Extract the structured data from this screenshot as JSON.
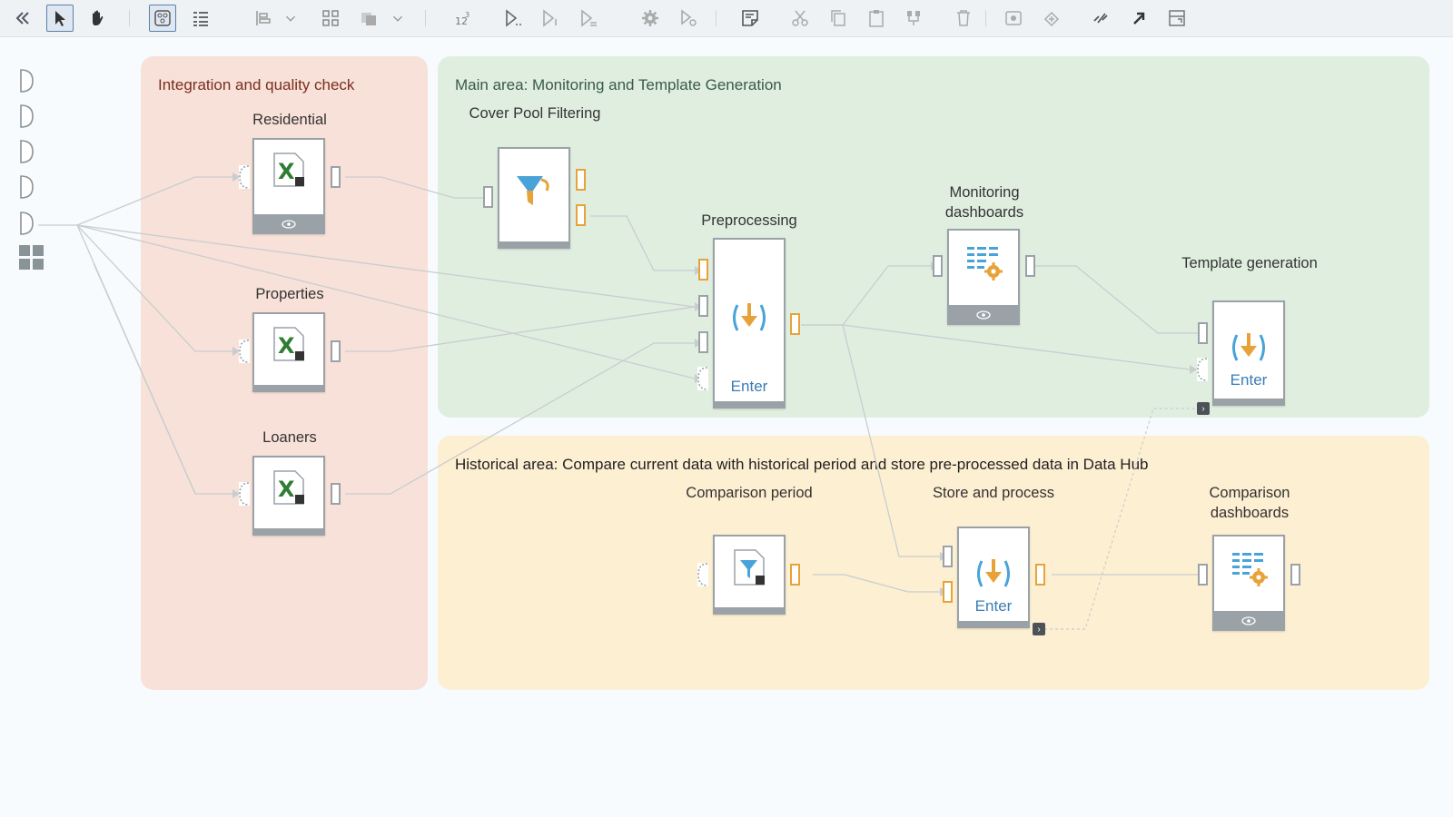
{
  "toolbar": {
    "tools": [
      {
        "name": "collapse-icon",
        "selected": false
      },
      {
        "name": "select-arrow-icon",
        "selected": true
      },
      {
        "name": "pan-hand-icon",
        "selected": false
      },
      {
        "name": "workflow-view-icon",
        "selected": true
      },
      {
        "name": "list-view-icon",
        "selected": false
      },
      {
        "name": "align-icon",
        "selected": false
      },
      {
        "name": "layout-icon",
        "selected": false
      },
      {
        "name": "arrange-icon",
        "selected": false
      },
      {
        "name": "numbering-icon",
        "selected": false
      },
      {
        "name": "run-all-icon",
        "selected": false
      },
      {
        "name": "run-step-icon",
        "selected": false
      },
      {
        "name": "run-selected-icon",
        "selected": false
      },
      {
        "name": "settings-gear-icon",
        "selected": false
      },
      {
        "name": "run-settings-icon",
        "selected": false
      },
      {
        "name": "note-icon",
        "selected": false
      },
      {
        "name": "cut-icon",
        "selected": false
      },
      {
        "name": "copy-icon",
        "selected": false
      },
      {
        "name": "paste-icon",
        "selected": false
      },
      {
        "name": "group-icon",
        "selected": false
      },
      {
        "name": "delete-icon",
        "selected": false
      },
      {
        "name": "preview-icon",
        "selected": false
      },
      {
        "name": "connect-icon",
        "selected": false
      },
      {
        "name": "link-icon",
        "selected": false
      },
      {
        "name": "export-icon",
        "selected": false
      },
      {
        "name": "fit-frame-icon",
        "selected": false
      }
    ]
  },
  "areas": {
    "integration": {
      "title": "Integration and quality check",
      "color": "#f8e1d8",
      "title_color": "#7a2e1f"
    },
    "main": {
      "title": "Main area: Monitoring and Template Generation",
      "color": "#e0eee0",
      "title_color": "#3a5a4a"
    },
    "historical": {
      "title": "Historical area: Compare current data with historical period and store pre-processed data in Data Hub",
      "color": "#fdefd1",
      "title_color": "#222"
    }
  },
  "nodes": {
    "residential": {
      "label": "Residential",
      "icon": "excel-icon"
    },
    "properties": {
      "label": "Properties",
      "icon": "excel-icon"
    },
    "loaners": {
      "label": "Loaners",
      "icon": "excel-icon"
    },
    "cover_pool": {
      "label": "Cover Pool Filtering",
      "icon": "funnel-filter-icon"
    },
    "preprocessing": {
      "label": "Preprocessing",
      "icon": "process-icon",
      "action": "Enter"
    },
    "monitoring": {
      "label": "Monitoring dashboards",
      "icon": "dashboard-icon"
    },
    "template": {
      "label": "Template generation",
      "icon": "process-icon",
      "action": "Enter"
    },
    "comparison_period": {
      "label": "Comparison period",
      "icon": "data-file-icon"
    },
    "store": {
      "label": "Store and process",
      "icon": "process-icon",
      "action": "Enter"
    },
    "comparison_dash": {
      "label": "Comparison dashboards",
      "icon": "dashboard-icon"
    }
  },
  "colors": {
    "port_orange": "#e8a23a",
    "port_grey": "#9aa2a8",
    "enter_blue": "#3a7cb4",
    "wire": "#c8cdd0"
  }
}
